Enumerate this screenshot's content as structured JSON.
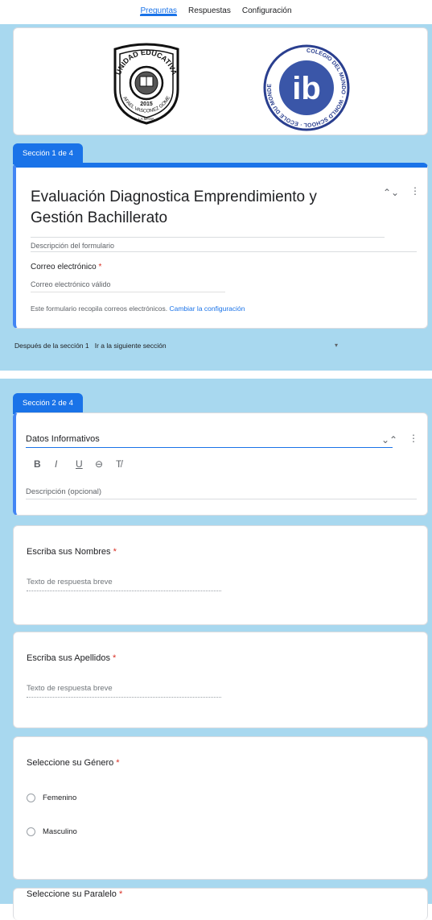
{
  "tabs": [
    {
      "label": "Preguntas",
      "active": true
    },
    {
      "label": "Respuestas",
      "active": false
    },
    {
      "label": "Configuración",
      "active": false
    }
  ],
  "header": {
    "logo_left_text": "UNIDAD EDUCATIVA",
    "logo_left_year": "2015",
    "logo_left_name": "RAFAEL VASCONEZ GOMEZ",
    "logo_left_place": "LA MANA",
    "logo_right_ring": "COLEGIO DEL MUNDO · WORLD SCHOOL · ECOLE DU MONDE",
    "logo_right_mark": "ib"
  },
  "section1": {
    "tab_label": "Sección 1 de 4",
    "title": "Evaluación Diagnostica Emprendimiento y Gestión Bachillerato",
    "description_placeholder": "Descripción del formulario",
    "email_label": "Correo electrónico",
    "email_placeholder": "Correo electrónico válido",
    "collect_info": "Este formulario recopila correos electrónicos.",
    "change_settings": "Cambiar la configuración",
    "after_label": "Después de la sección 1",
    "after_value": "Ir a la siguiente sección"
  },
  "section2": {
    "tab_label": "Sección 2 de 4",
    "title": "Datos Informativos",
    "description_placeholder": "Descripción (opcional)",
    "format": {
      "bold": "B",
      "italic": "I",
      "underline": "U",
      "link": "⊖",
      "clear": "T̸"
    }
  },
  "questions": [
    {
      "title": "Escriba sus Nombres",
      "hint": "Texto de respuesta breve"
    },
    {
      "title": "Escriba sus Apellidos",
      "hint": "Texto de respuesta breve"
    },
    {
      "title": "Seleccione su Género",
      "options": [
        "Femenino",
        "Masculino"
      ]
    },
    {
      "title": "Seleccione su Paralelo"
    }
  ],
  "colors": {
    "accent": "#1a73e8",
    "background": "#a8d8ef",
    "required": "#d93025"
  }
}
